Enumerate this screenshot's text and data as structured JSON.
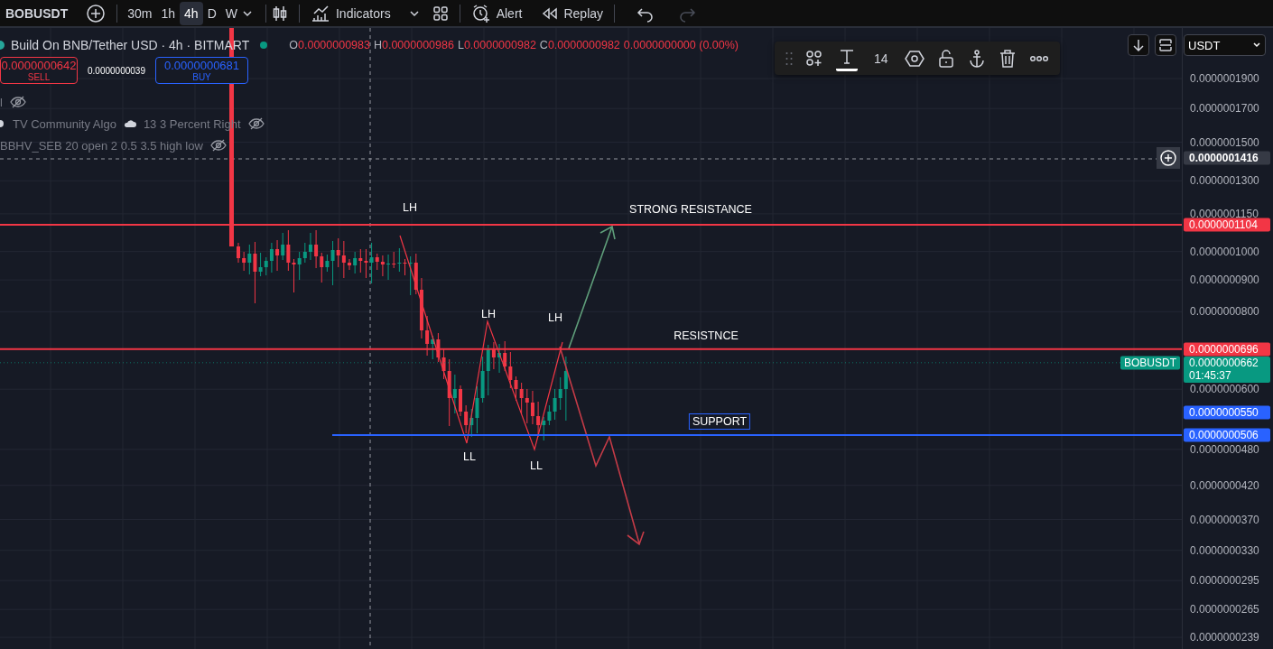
{
  "top_toolbar": {
    "symbol": "BOBUSDT",
    "intervals": [
      {
        "label": "30m",
        "selected": false
      },
      {
        "label": "1h",
        "selected": false
      },
      {
        "label": "4h",
        "selected": true
      },
      {
        "label": "D",
        "selected": false
      },
      {
        "label": "W",
        "selected": false
      }
    ],
    "indicators_button": "Indicators",
    "alert_button": "Alert",
    "replay_button": "Replay",
    "redo": {
      "disabled": true
    }
  },
  "legend": {
    "title": "Build On BNB/Tether USD · 4h · BITMART",
    "ohlc": [
      {
        "label": "O",
        "value": "0.0000000983"
      },
      {
        "label": "H",
        "value": "0.0000000986"
      },
      {
        "label": "L",
        "value": "0.0000000982"
      },
      {
        "label": "C",
        "value": "0.0000000982"
      }
    ],
    "change": "0.0000000000 (0.00%)",
    "sell": {
      "price": "0.0000000642",
      "label": "SELL"
    },
    "spread": "0.0000000039",
    "buy": {
      "price": "0.0000000681",
      "label": "BUY"
    },
    "studies": [
      {
        "name": "l"
      },
      {
        "name": "TV Community Algo",
        "params": "13 3 Percent Right"
      },
      {
        "name": "BBHV_SEB 20 open 2 0.5 3.5 high low"
      }
    ]
  },
  "drawing_toolbar": {
    "text_tool_selected": true,
    "font_size": "14"
  },
  "price_scale": {
    "currency": "USDT",
    "ticks": [
      "0.0000001900",
      "0.0000001700",
      "0.0000001500",
      "0.0000001300",
      "0.0000001150",
      "0.0000001000",
      "0.0000000900",
      "0.0000000800",
      "0.0000000600",
      "0.0000000480",
      "0.0000000420",
      "0.0000000370",
      "0.0000000330",
      "0.0000000295",
      "0.0000000265",
      "0.0000000239"
    ]
  },
  "price_labels": [
    {
      "kind": "crosshair",
      "value": "0.0000001416",
      "color": "#363a45"
    },
    {
      "kind": "line",
      "value": "0.0000001104",
      "color": "#f23645"
    },
    {
      "kind": "line",
      "value": "0.0000000696",
      "color": "#f23645"
    },
    {
      "kind": "last",
      "symbol": "BOBUSDT",
      "value": "0.0000000662",
      "countdown": "01:45:37",
      "color": "#089981"
    },
    {
      "kind": "label",
      "value": "0.0000000550",
      "color": "#2962ff"
    },
    {
      "kind": "ray",
      "value": "0.0000000506",
      "color": "#2962ff"
    }
  ],
  "annotations": [
    {
      "text": "LH",
      "boxed": false
    },
    {
      "text": "STRONG RESISTANCE",
      "boxed": false
    },
    {
      "text": "LH",
      "boxed": false
    },
    {
      "text": "LH",
      "boxed": false
    },
    {
      "text": "RESISTNCE",
      "boxed": false
    },
    {
      "text": "SUPPORT",
      "boxed": true
    },
    {
      "text": "LL",
      "boxed": false
    },
    {
      "text": "LL",
      "boxed": false
    }
  ]
}
